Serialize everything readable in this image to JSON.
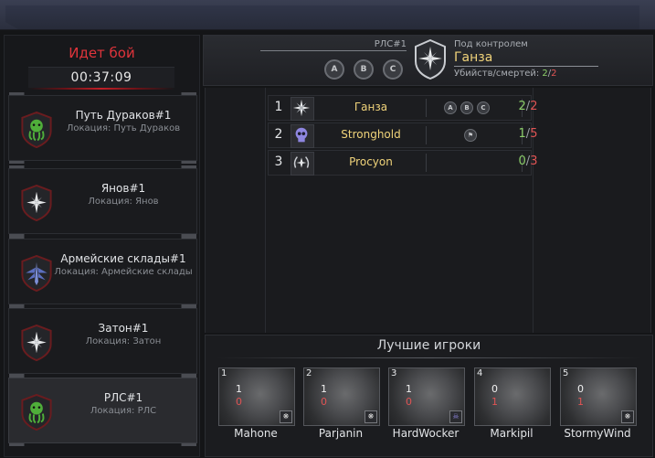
{
  "battle": {
    "status": "Идет бой",
    "timer": "00:37:09"
  },
  "locations": [
    {
      "name": "Путь Дураков#1",
      "sub": "Локация: Путь Дураков",
      "icon": "octopus-green-icon",
      "active": false
    },
    {
      "name": "Янов#1",
      "sub": "Локация: Янов",
      "icon": "compass-star-icon",
      "active": false
    },
    {
      "name": "Армейские склады#1",
      "sub": "Локация: Армейские склады",
      "icon": "wings-blue-icon",
      "active": false
    },
    {
      "name": "Затон#1",
      "sub": "Локация: Затон",
      "icon": "compass-star-icon",
      "active": false
    },
    {
      "name": "РЛС#1",
      "sub": "Локация: РЛС",
      "icon": "octopus-green-icon",
      "active": true
    }
  ],
  "header": {
    "point_name": "РЛС#1",
    "points": [
      "A",
      "B",
      "C"
    ],
    "control_label": "Под контролем",
    "control_name": "Ганза",
    "kd_label": "Убийств/смертей:",
    "kills": "2",
    "deaths": "2"
  },
  "teams": [
    {
      "rank": "1",
      "name": "Ганза",
      "icon": "compass-star-icon",
      "marks": [
        "A",
        "B",
        "C"
      ],
      "kills": "2",
      "deaths": "2"
    },
    {
      "rank": "2",
      "name": "Stronghold",
      "icon": "skull-purple-icon",
      "marks": [
        "flag"
      ],
      "kills": "1",
      "deaths": "5"
    },
    {
      "rank": "3",
      "name": "Procyon",
      "icon": "laurel-star-icon",
      "marks": [],
      "kills": "0",
      "deaths": "3"
    }
  ],
  "best": {
    "title": "Лучшие игроки",
    "players": [
      {
        "idx": "1",
        "name": "Mahone",
        "kills": "1",
        "deaths": "0",
        "badge": "compass-star-icon"
      },
      {
        "idx": "2",
        "name": "Parjanin",
        "kills": "1",
        "deaths": "0",
        "badge": "compass-star-icon"
      },
      {
        "idx": "3",
        "name": "HardWocker",
        "kills": "1",
        "deaths": "0",
        "badge": "skull-purple-icon"
      },
      {
        "idx": "4",
        "name": "Markipil",
        "kills": "0",
        "deaths": "1",
        "badge": ""
      },
      {
        "idx": "5",
        "name": "StormyWind",
        "kills": "0",
        "deaths": "1",
        "badge": "compass-star-icon"
      }
    ]
  },
  "colors": {
    "accent_red": "#e0343b",
    "team_name": "#f0d37a",
    "kills": "#8ccf6a",
    "deaths": "#e05454"
  }
}
